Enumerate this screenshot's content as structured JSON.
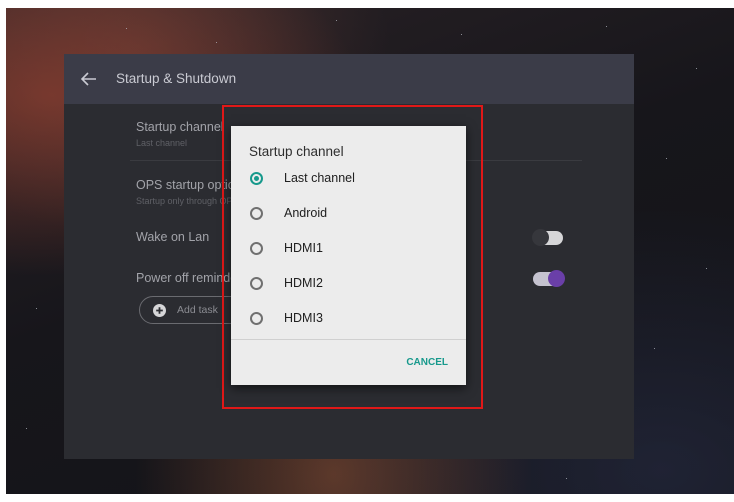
{
  "header": {
    "title": "Startup & Shutdown"
  },
  "settings": {
    "startup_channel": {
      "title": "Startup channel",
      "subtitle": "Last channel"
    },
    "ops_startup": {
      "title": "OPS startup option",
      "subtitle": "Startup only through OPS"
    },
    "wake_on_lan": {
      "title": "Wake on Lan",
      "enabled": false
    },
    "power_off_reminder": {
      "title": "Power off reminder",
      "enabled": true
    },
    "add_task_label": "Add task"
  },
  "dialog": {
    "title": "Startup channel",
    "options": [
      {
        "label": "Last channel",
        "selected": true
      },
      {
        "label": "Android",
        "selected": false
      },
      {
        "label": "HDMI1",
        "selected": false
      },
      {
        "label": "HDMI2",
        "selected": false
      },
      {
        "label": "HDMI3",
        "selected": false
      }
    ],
    "cancel_label": "CANCEL"
  },
  "colors": {
    "accent": "#17998c",
    "toggle_on": "#6a3fa8",
    "highlight_box": "#e01818"
  }
}
